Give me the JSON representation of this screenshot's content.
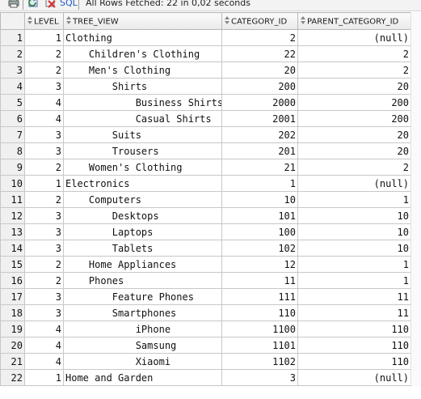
{
  "toolbar": {
    "items": [
      {
        "icon": "print-icon"
      },
      {
        "icon": "sql-refresh-icon"
      },
      {
        "icon": "cancel-query-icon"
      }
    ],
    "sql_label": "SQL",
    "status_text": "All Rows Fetched: 22 in 0,02 seconds"
  },
  "grid": {
    "columns": [
      {
        "label": "LEVEL"
      },
      {
        "label": "TREE_VIEW"
      },
      {
        "label": "CATEGORY_ID"
      },
      {
        "label": "PARENT_CATEGORY_ID"
      }
    ],
    "rows": [
      {
        "n": "1",
        "level": "1",
        "tree": "Clothing",
        "category_id": "2",
        "parent_id": "(null)"
      },
      {
        "n": "2",
        "level": "2",
        "tree": "    Children's Clothing",
        "category_id": "22",
        "parent_id": "2"
      },
      {
        "n": "3",
        "level": "2",
        "tree": "    Men's Clothing",
        "category_id": "20",
        "parent_id": "2"
      },
      {
        "n": "4",
        "level": "3",
        "tree": "        Shirts",
        "category_id": "200",
        "parent_id": "20"
      },
      {
        "n": "5",
        "level": "4",
        "tree": "            Business Shirts",
        "category_id": "2000",
        "parent_id": "200"
      },
      {
        "n": "6",
        "level": "4",
        "tree": "            Casual Shirts",
        "category_id": "2001",
        "parent_id": "200"
      },
      {
        "n": "7",
        "level": "3",
        "tree": "        Suits",
        "category_id": "202",
        "parent_id": "20"
      },
      {
        "n": "8",
        "level": "3",
        "tree": "        Trousers",
        "category_id": "201",
        "parent_id": "20"
      },
      {
        "n": "9",
        "level": "2",
        "tree": "    Women's Clothing",
        "category_id": "21",
        "parent_id": "2"
      },
      {
        "n": "10",
        "level": "1",
        "tree": "Electronics",
        "category_id": "1",
        "parent_id": "(null)"
      },
      {
        "n": "11",
        "level": "2",
        "tree": "    Computers",
        "category_id": "10",
        "parent_id": "1"
      },
      {
        "n": "12",
        "level": "3",
        "tree": "        Desktops",
        "category_id": "101",
        "parent_id": "10"
      },
      {
        "n": "13",
        "level": "3",
        "tree": "        Laptops",
        "category_id": "100",
        "parent_id": "10"
      },
      {
        "n": "14",
        "level": "3",
        "tree": "        Tablets",
        "category_id": "102",
        "parent_id": "10"
      },
      {
        "n": "15",
        "level": "2",
        "tree": "    Home Appliances",
        "category_id": "12",
        "parent_id": "1"
      },
      {
        "n": "16",
        "level": "2",
        "tree": "    Phones",
        "category_id": "11",
        "parent_id": "1"
      },
      {
        "n": "17",
        "level": "3",
        "tree": "        Feature Phones",
        "category_id": "111",
        "parent_id": "11"
      },
      {
        "n": "18",
        "level": "3",
        "tree": "        Smartphones",
        "category_id": "110",
        "parent_id": "11"
      },
      {
        "n": "19",
        "level": "4",
        "tree": "            iPhone",
        "category_id": "1100",
        "parent_id": "110"
      },
      {
        "n": "20",
        "level": "4",
        "tree": "            Samsung",
        "category_id": "1101",
        "parent_id": "110"
      },
      {
        "n": "21",
        "level": "4",
        "tree": "            Xiaomi",
        "category_id": "1102",
        "parent_id": "110"
      },
      {
        "n": "22",
        "level": "1",
        "tree": "Home and Garden",
        "category_id": "3",
        "parent_id": "(null)"
      }
    ]
  }
}
